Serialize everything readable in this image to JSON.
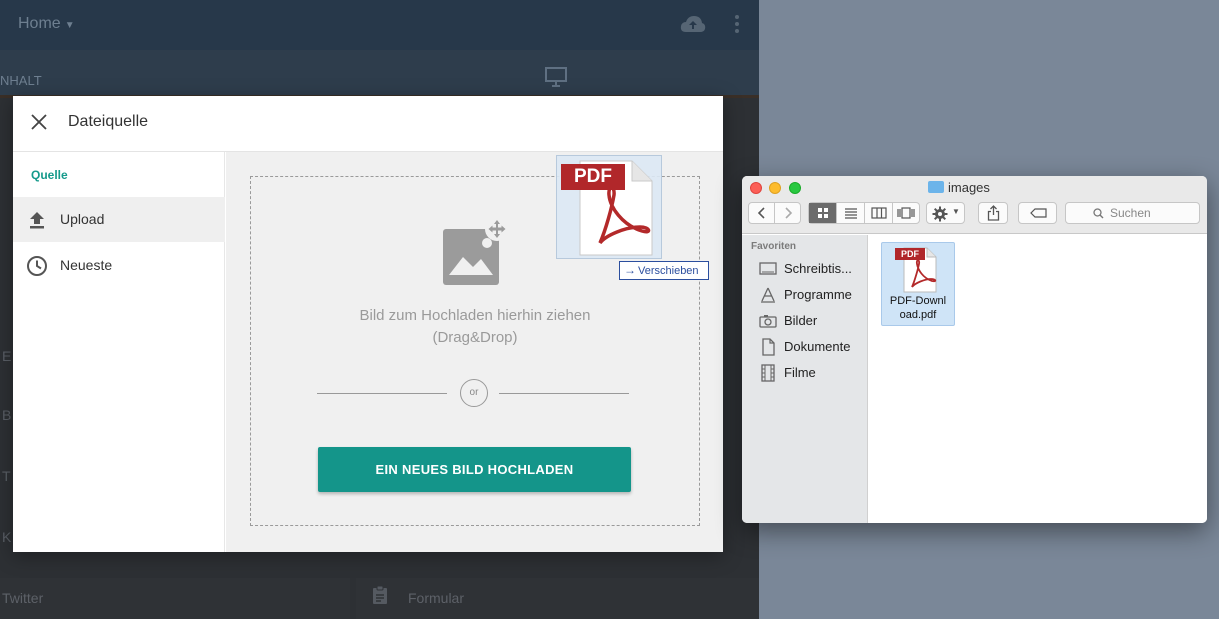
{
  "background_app": {
    "home_label": "Home",
    "section_label": "NHALT",
    "side_letters": [
      "E",
      "B",
      "T",
      "K"
    ],
    "bottom_items": [
      "Twitter",
      "Formular"
    ]
  },
  "modal": {
    "title": "Dateiquelle",
    "sidebar": {
      "heading": "Quelle",
      "items": [
        {
          "label": "Upload",
          "icon": "upload-icon",
          "active": true
        },
        {
          "label": "Neueste",
          "icon": "clock-icon",
          "active": false
        }
      ]
    },
    "dropzone": {
      "text_line1": "Bild zum Hochladen hierhin ziehen",
      "text_line2": "(Drag&Drop)",
      "or_label": "or",
      "upload_button_label": "EIN NEUES BILD HOCHLADEN"
    },
    "accent_color": "#14958a"
  },
  "drag": {
    "badge": "PDF",
    "tooltip": "Verschieben"
  },
  "finder": {
    "title": "images",
    "search_placeholder": "Suchen",
    "favorites_heading": "Favoriten",
    "favorites": [
      {
        "label": "Schreibtis...",
        "icon": "desktop-icon"
      },
      {
        "label": "Programme",
        "icon": "applications-icon"
      },
      {
        "label": "Bilder",
        "icon": "camera-icon"
      },
      {
        "label": "Dokumente",
        "icon": "documents-icon"
      },
      {
        "label": "Filme",
        "icon": "film-icon"
      }
    ],
    "files": [
      {
        "badge": "PDF",
        "name_line1": "PDF-Downl",
        "name_line2": "oad.pdf"
      }
    ]
  }
}
